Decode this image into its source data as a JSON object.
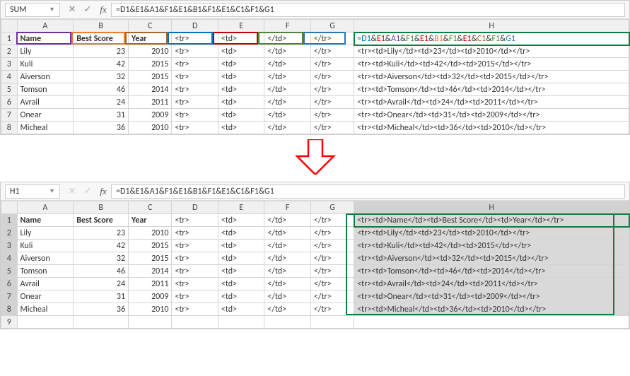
{
  "top": {
    "namebox": "SUM",
    "formula_plain": "=D1&E1&A1&F1&E1&B1&F1&E1&C1&F1&G1",
    "formula_colored": [
      {
        "t": "=",
        "c": ""
      },
      {
        "t": "D1",
        "c": "cblue"
      },
      {
        "t": "&",
        "c": ""
      },
      {
        "t": "E1",
        "c": "cdred"
      },
      {
        "t": "&",
        "c": ""
      },
      {
        "t": "A1",
        "c": "cpurp"
      },
      {
        "t": "&",
        "c": ""
      },
      {
        "t": "F1",
        "c": "cgreen"
      },
      {
        "t": "&",
        "c": ""
      },
      {
        "t": "E1",
        "c": "cdred"
      },
      {
        "t": "&",
        "c": ""
      },
      {
        "t": "B1",
        "c": "corg"
      },
      {
        "t": "&",
        "c": ""
      },
      {
        "t": "F1",
        "c": "cgreen"
      },
      {
        "t": "&",
        "c": ""
      },
      {
        "t": "E1",
        "c": "cdred"
      },
      {
        "t": "&",
        "c": ""
      },
      {
        "t": "C1",
        "c": "cbrown"
      },
      {
        "t": "&",
        "c": ""
      },
      {
        "t": "F1",
        "c": "cgreen"
      },
      {
        "t": "&",
        "c": ""
      },
      {
        "t": "G1",
        "c": "cteal"
      }
    ],
    "active_cell_display": [
      {
        "t": "=",
        "c": ""
      },
      {
        "t": "D1",
        "c": "cblue"
      },
      {
        "t": "&",
        "c": ""
      },
      {
        "t": "E1",
        "c": "cdred"
      },
      {
        "t": "&",
        "c": ""
      },
      {
        "t": "A1",
        "c": "cpurp"
      },
      {
        "t": "&",
        "c": ""
      },
      {
        "t": "F1",
        "c": "cgreen"
      },
      {
        "t": "&",
        "c": ""
      },
      {
        "t": "E1",
        "c": "cdred"
      },
      {
        "t": "&",
        "c": ""
      },
      {
        "t": "B1",
        "c": "corg"
      },
      {
        "t": "&",
        "c": ""
      },
      {
        "t": "F1",
        "c": "cgreen"
      },
      {
        "t": "&",
        "c": ""
      },
      {
        "t": "E1",
        "c": "cdred"
      },
      {
        "t": "&",
        "c": ""
      },
      {
        "t": "C1",
        "c": "cbrown"
      },
      {
        "t": "&",
        "c": ""
      },
      {
        "t": "F1",
        "c": "cgreen"
      },
      {
        "t": "&",
        "c": ""
      },
      {
        "t": "G1",
        "c": "cteal"
      }
    ],
    "col_headers": [
      "A",
      "B",
      "C",
      "D",
      "E",
      "F",
      "G",
      "H"
    ],
    "rows": [
      {
        "r": 1,
        "A": "Name",
        "B": "Best Score",
        "C": "Year",
        "D": "<tr>",
        "E": "<td>",
        "F": "</td>",
        "G": "</tr>",
        "H_formula": true,
        "bold": true
      },
      {
        "r": 2,
        "A": "Lily",
        "B": 23,
        "C": 2010,
        "D": "<tr>",
        "E": "<td>",
        "F": "</td>",
        "G": "</tr>",
        "H": "<tr><td>Lily</td><td>23</td><td>2010</td></tr>"
      },
      {
        "r": 3,
        "A": "Kuli",
        "B": 42,
        "C": 2015,
        "D": "<tr>",
        "E": "<td>",
        "F": "</td>",
        "G": "</tr>",
        "H": "<tr><td>Kuli</td><td>42</td><td>2015</td></tr>"
      },
      {
        "r": 4,
        "A": "Aiverson",
        "B": 32,
        "C": 2015,
        "D": "<tr>",
        "E": "<td>",
        "F": "</td>",
        "G": "</tr>",
        "H": "<tr><td>Aiverson</td><td>32</td><td>2015</td></tr>"
      },
      {
        "r": 5,
        "A": "Tomson",
        "B": 46,
        "C": 2014,
        "D": "<tr>",
        "E": "<td>",
        "F": "</td>",
        "G": "</tr>",
        "H": "<tr><td>Tomson</td><td>46</td><td>2014</td></tr>"
      },
      {
        "r": 6,
        "A": "Avrail",
        "B": 24,
        "C": 2011,
        "D": "<tr>",
        "E": "<td>",
        "F": "</td>",
        "G": "</tr>",
        "H": "<tr><td>Avrail</td><td>24</td><td>2011</td></tr>"
      },
      {
        "r": 7,
        "A": "Onear",
        "B": 31,
        "C": 2009,
        "D": "<tr>",
        "E": "<td>",
        "F": "</td>",
        "G": "</tr>",
        "H": "<tr><td>Onear</td><td>31</td><td>2009</td></tr>"
      },
      {
        "r": 8,
        "A": "Micheal",
        "B": 36,
        "C": 2010,
        "D": "<tr>",
        "E": "<td>",
        "F": "</td>",
        "G": "</tr>",
        "H": "<tr><td>Micheal</td><td>36</td><td>2010</td></tr>"
      }
    ],
    "hilite_colors": {
      "A": "#7030a0",
      "B": "#ed7d31",
      "C": "#a5672a",
      "D": "#0070c0",
      "E": "#c00000",
      "F": "#548235",
      "G": "#2e75b6"
    }
  },
  "bottom": {
    "namebox": "H1",
    "formula_plain": "=D1&E1&A1&F1&E1&B1&F1&E1&C1&F1&G1",
    "col_headers": [
      "A",
      "B",
      "C",
      "D",
      "E",
      "F",
      "G",
      "H"
    ],
    "rows": [
      {
        "r": 1,
        "A": "Name",
        "B": "Best Score",
        "C": "Year",
        "D": "<tr>",
        "E": "<td>",
        "F": "</td>",
        "G": "</tr>",
        "H": "<tr><td>Name</td><td>Best Score</td><td>Year</td></tr>",
        "bold": true
      },
      {
        "r": 2,
        "A": "Lily",
        "B": 23,
        "C": 2010,
        "D": "<tr>",
        "E": "<td>",
        "F": "</td>",
        "G": "</tr>",
        "H": "<tr><td>Lily</td><td>23</td><td>2010</td></tr>"
      },
      {
        "r": 3,
        "A": "Kuli",
        "B": 42,
        "C": 2015,
        "D": "<tr>",
        "E": "<td>",
        "F": "</td>",
        "G": "</tr>",
        "H": "<tr><td>Kuli</td><td>42</td><td>2015</td></tr>"
      },
      {
        "r": 4,
        "A": "Aiverson",
        "B": 32,
        "C": 2015,
        "D": "<tr>",
        "E": "<td>",
        "F": "</td>",
        "G": "</tr>",
        "H": "<tr><td>Aiverson</td><td>32</td><td>2015</td></tr>"
      },
      {
        "r": 5,
        "A": "Tomson",
        "B": 46,
        "C": 2014,
        "D": "<tr>",
        "E": "<td>",
        "F": "</td>",
        "G": "</tr>",
        "H": "<tr><td>Tomson</td><td>46</td><td>2014</td></tr>"
      },
      {
        "r": 6,
        "A": "Avrail",
        "B": 24,
        "C": 2011,
        "D": "<tr>",
        "E": "<td>",
        "F": "</td>",
        "G": "</tr>",
        "H": "<tr><td>Avrail</td><td>24</td><td>2011</td></tr>"
      },
      {
        "r": 7,
        "A": "Onear",
        "B": 31,
        "C": 2009,
        "D": "<tr>",
        "E": "<td>",
        "F": "</td>",
        "G": "</tr>",
        "H": "<tr><td>Onear</td><td>31</td><td>2009</td></tr>"
      },
      {
        "r": 8,
        "A": "Micheal",
        "B": 36,
        "C": 2010,
        "D": "<tr>",
        "E": "<td>",
        "F": "</td>",
        "G": "</tr>",
        "H": "<tr><td>Micheal</td><td>36</td><td>2010</td></tr>"
      },
      {
        "r": 9,
        "A": "",
        "B": "",
        "C": "",
        "D": "",
        "E": "",
        "F": "",
        "G": "",
        "H": ""
      }
    ]
  }
}
